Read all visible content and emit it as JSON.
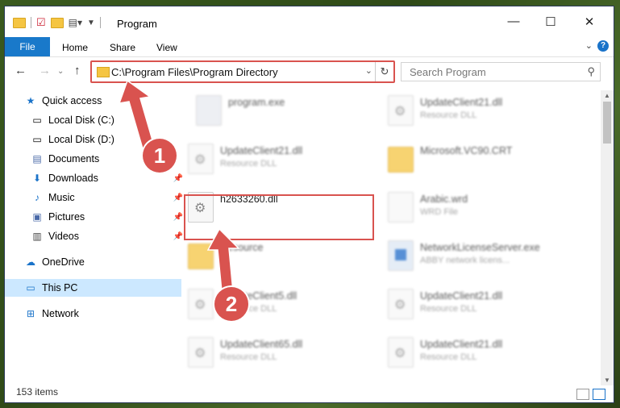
{
  "window": {
    "title": "Program",
    "controls": {
      "minimize": "—",
      "maximize": "☐",
      "close": "✕"
    }
  },
  "ribbon": {
    "file": "File",
    "tabs": [
      "Home",
      "Share",
      "View"
    ],
    "help": "?"
  },
  "nav": {
    "back": "←",
    "forward": "→",
    "up": "↑",
    "address": "C:\\Program Files\\Program Directory",
    "dropdown": "⌄",
    "refresh": "↻",
    "search_placeholder": "Search Program",
    "search_icon": "search-icon"
  },
  "sidebar": {
    "quick_access": "Quick access",
    "items": [
      {
        "label": "Local Disk (C:)",
        "icon": "drive-icon"
      },
      {
        "label": "Local Disk (D:)",
        "icon": "drive-icon"
      },
      {
        "label": "Documents",
        "icon": "documents-icon"
      },
      {
        "label": "Downloads",
        "icon": "downloads-icon",
        "pinned": true
      },
      {
        "label": "Music",
        "icon": "music-icon",
        "pinned": true
      },
      {
        "label": "Pictures",
        "icon": "pictures-icon",
        "pinned": true
      },
      {
        "label": "Videos",
        "icon": "videos-icon",
        "pinned": true
      }
    ],
    "onedrive": "OneDrive",
    "this_pc": "This PC",
    "network": "Network"
  },
  "files": [
    {
      "name": "program.exe",
      "type": ""
    },
    {
      "name": "UpdateClient21.dll",
      "type": "Resource DLL"
    },
    {
      "name": "UpdateClient21.dll",
      "type": "Resource DLL"
    },
    {
      "name": "Microsoft.VC90.CRT",
      "type": ""
    },
    {
      "name": "h2633260.dll",
      "type": ""
    },
    {
      "name": "Arabic.wrd",
      "type": "WRD File"
    },
    {
      "name": "Resource",
      "type": ""
    },
    {
      "name": "NetworkLicenseServer.exe",
      "type": "ABBY network licens..."
    },
    {
      "name": "UpdateClient5.dll",
      "type": "Resource DLL"
    },
    {
      "name": "UpdateClient21.dll",
      "type": "Resource DLL"
    },
    {
      "name": "UpdateClient65.dll",
      "type": "Resource DLL"
    },
    {
      "name": "UpdateClient21.dll",
      "type": "Resource DLL"
    }
  ],
  "status": {
    "count": "153 items"
  },
  "callouts": [
    "1",
    "2"
  ],
  "colors": {
    "accent": "#1979ca",
    "highlight": "#d9534f",
    "selected": "#cce8ff"
  }
}
